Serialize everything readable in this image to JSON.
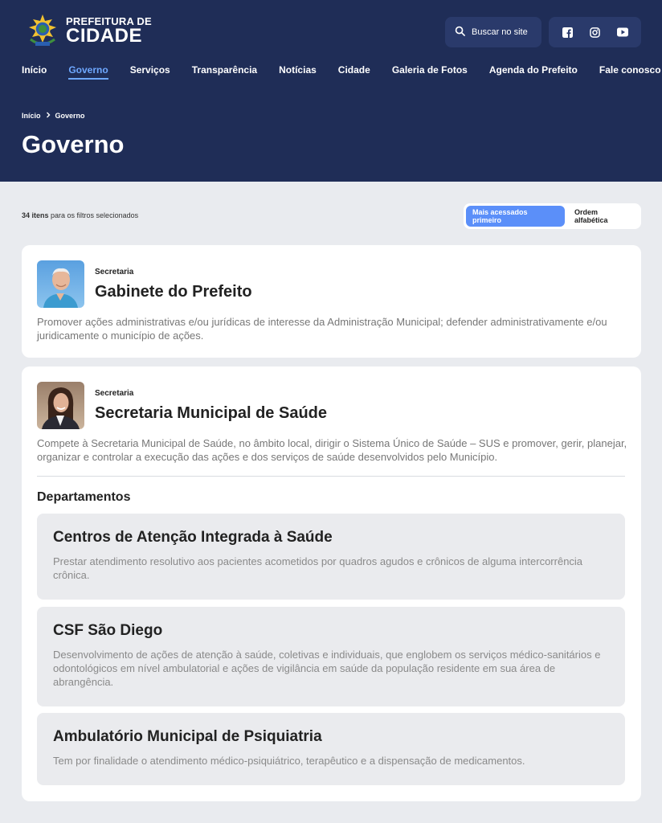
{
  "brand": {
    "line1": "PREFEITURA DE",
    "line2": "CIDADE"
  },
  "search": {
    "label": "Buscar no site"
  },
  "social": [
    "facebook-icon",
    "instagram-icon",
    "youtube-icon"
  ],
  "nav": [
    "Início",
    "Governo",
    "Serviços",
    "Transparência",
    "Notícias",
    "Cidade",
    "Galeria de Fotos",
    "Agenda do Prefeito",
    "Fale conosco"
  ],
  "breadcrumb": {
    "home": "Início",
    "current": "Governo"
  },
  "page_title": "Governo",
  "results": {
    "count": "34 itens",
    "suffix": " para os filtros selecionados"
  },
  "sort": {
    "option1": "Mais acessados primeiro",
    "option2": "Ordem alfabética",
    "selected": "Mais acessados primeiro"
  },
  "cards": [
    {
      "kicker": "Secretaria",
      "title": "Gabinete do Prefeito",
      "desc": "Promover ações administrativas e/ou jurídicas de interesse da Administração Municipal; defender administrativamente e/ou juridicamente o município de ações."
    },
    {
      "kicker": "Secretaria",
      "title": "Secretaria Municipal de Saúde",
      "desc": "Compete à Secretaria Municipal de Saúde, no âmbito local, dirigir o Sistema Único de Saúde – SUS e promover, gerir, planejar, organizar e controlar a execução das ações e dos serviços de saúde desenvolvidos pelo Município.",
      "departments_heading": "Departamentos",
      "departments": [
        {
          "title": "Centros de Atenção Integrada à Saúde",
          "desc": "Prestar atendimento resolutivo aos pacientes acometidos por quadros agudos e crônicos de alguma intercorrência crônica."
        },
        {
          "title": "CSF São Diego",
          "desc": "Desenvolvimento de ações de atenção à saúde, coletivas e individuais, que englobem os serviços médico-sanitários e odontológicos em nível ambulatorial e ações de vigilância em saúde da população residente em sua área de abrangência."
        },
        {
          "title": "Ambulatório Municipal de Psiquiatria",
          "desc": "Tem por finalidade o atendimento médico-psiquiátrico, terapêutico e a dispensação de medicamentos."
        }
      ]
    }
  ],
  "colors": {
    "header": "#1f2d57",
    "accent": "#5b8ff9",
    "nav_active": "#6ea8ff",
    "background": "#e9ebef"
  }
}
